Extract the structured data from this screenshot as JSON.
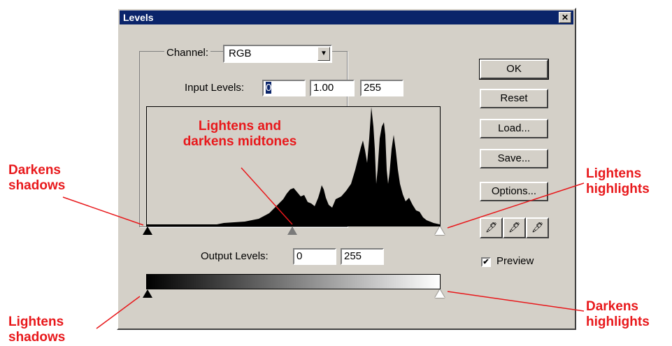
{
  "dialog": {
    "title": "Levels",
    "close_symbol": "✕",
    "channel_label": "Channel:",
    "channel_value": "RGB",
    "input_levels_label": "Input Levels:",
    "input_black": "0",
    "input_gamma": "1.00",
    "input_white": "255",
    "output_levels_label": "Output Levels:",
    "output_black": "0",
    "output_white": "255",
    "buttons": {
      "ok": "OK",
      "reset": "Reset",
      "load": "Load...",
      "save": "Save...",
      "options": "Options..."
    },
    "eyedroppers": [
      "black-eyedropper-icon",
      "gray-eyedropper-icon",
      "white-eyedropper-icon"
    ],
    "preview_label": "Preview",
    "preview_checked": true
  },
  "annotations": {
    "darkens_shadows": [
      "Darkens",
      "shadows"
    ],
    "midtones": [
      "Lightens and",
      "darkens midtones"
    ],
    "lightens_highlights": [
      "Lightens",
      "highlights"
    ],
    "lightens_shadows": [
      "Lightens",
      "shadows"
    ],
    "darkens_highlights": [
      "Darkens",
      "highlights"
    ]
  },
  "colors": {
    "dialog_bg": "#d4d0c8",
    "titlebar": "#0a246a",
    "annotation": "#e8181b"
  }
}
